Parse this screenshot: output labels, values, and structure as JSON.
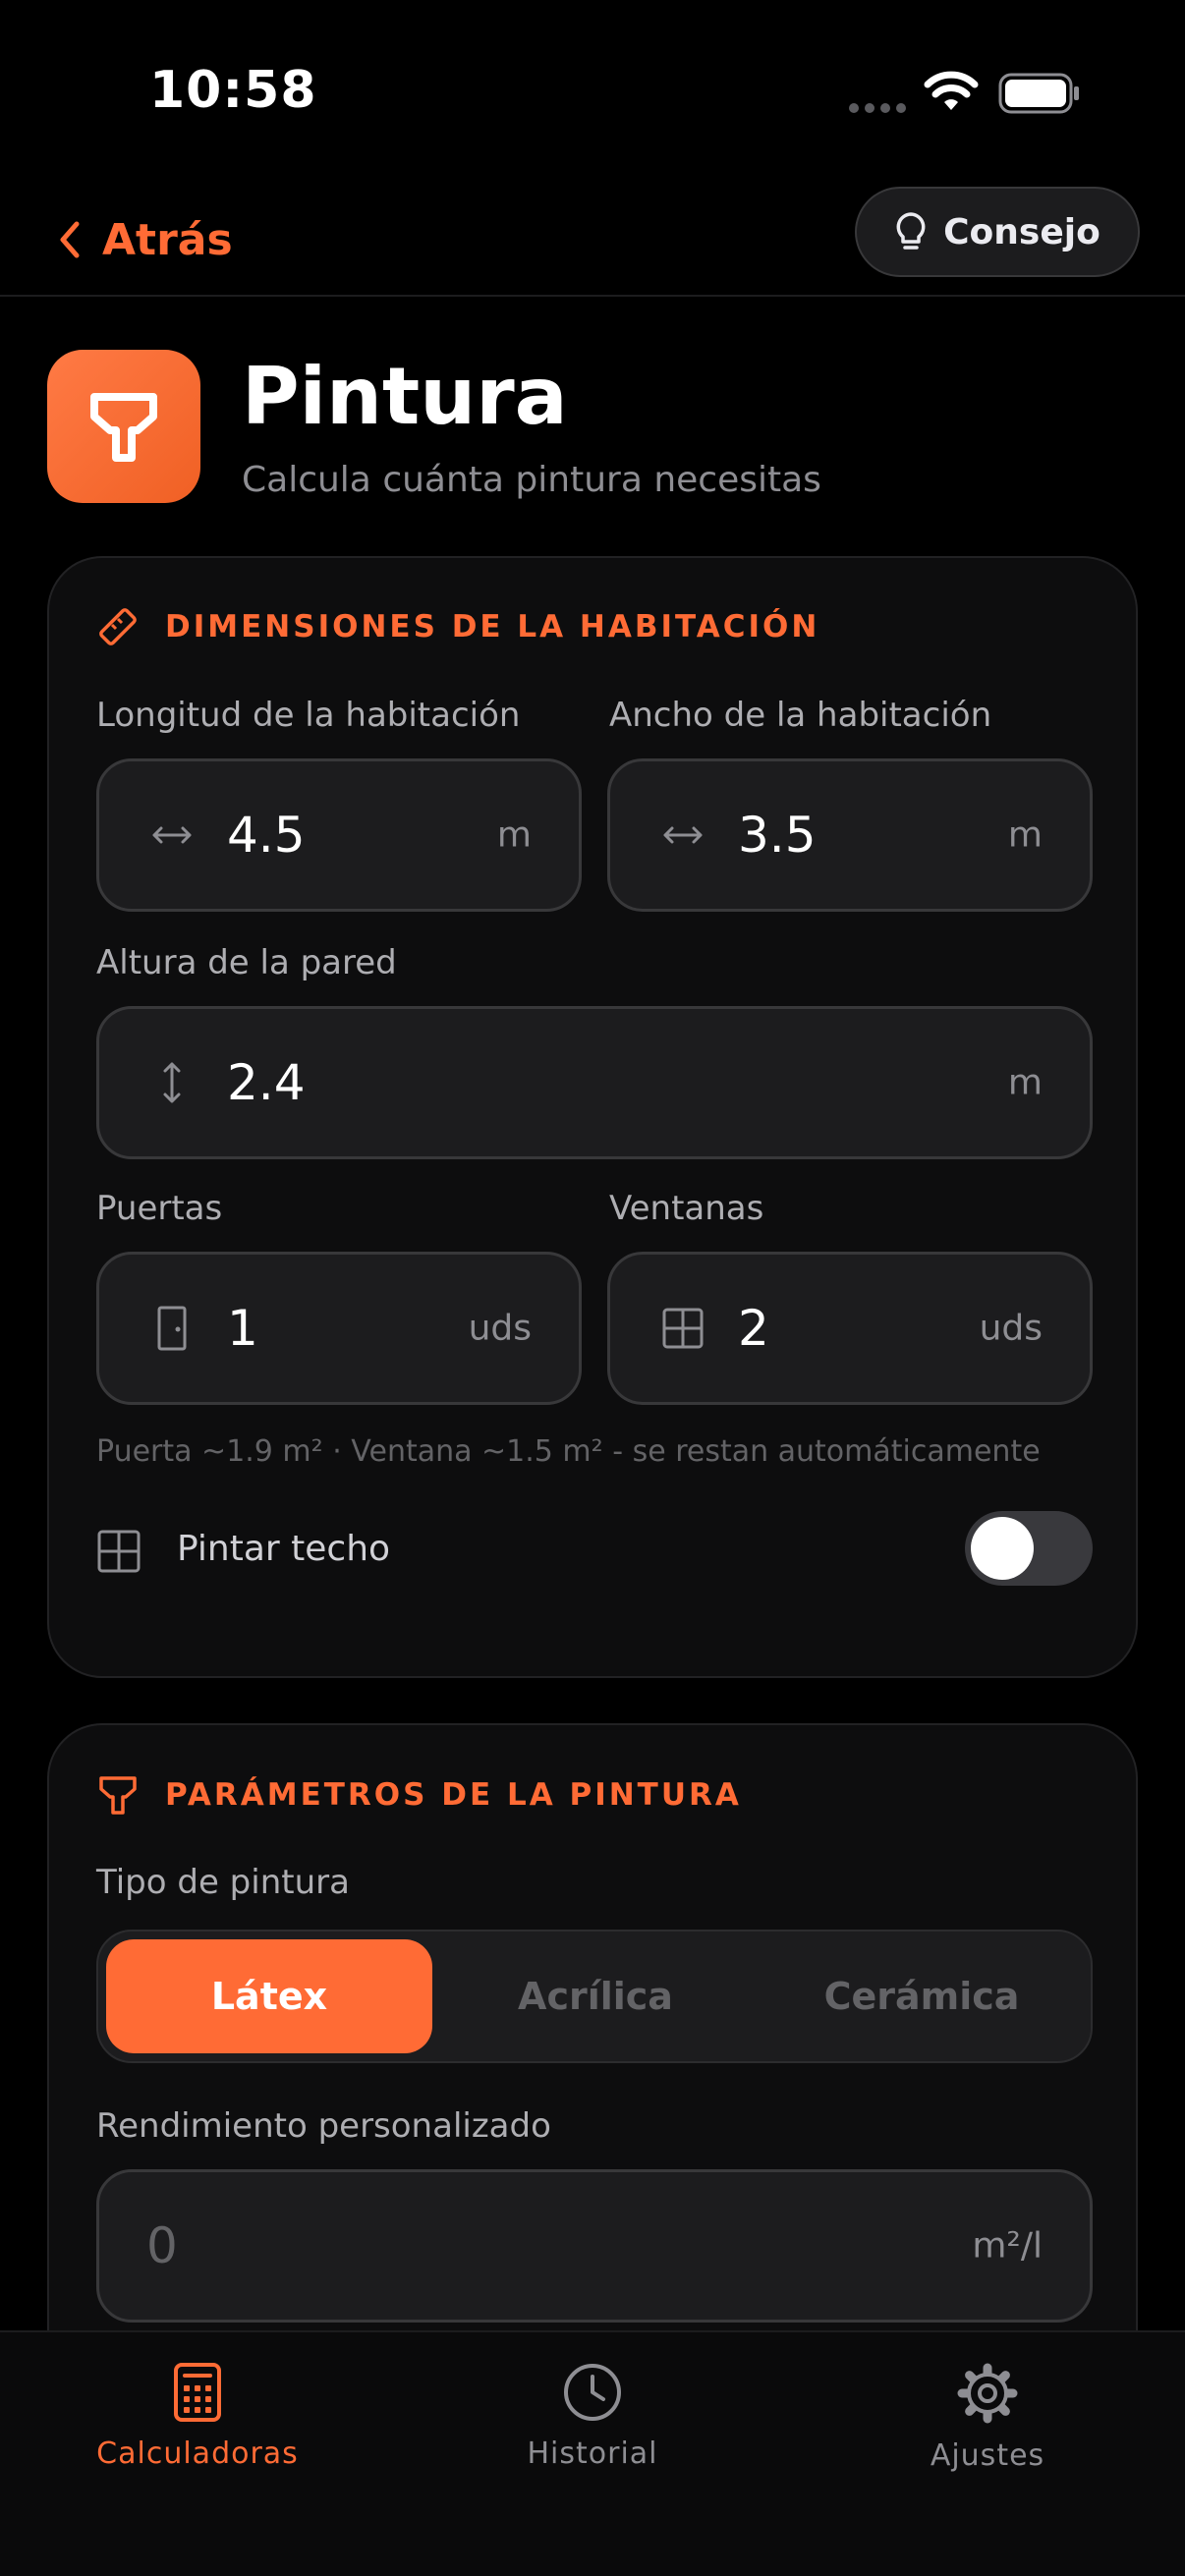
{
  "status_bar": {
    "time": "10:58"
  },
  "nav": {
    "back_label": "Atrás",
    "tip_label": "Consejo"
  },
  "header": {
    "title": "Pintura",
    "subtitle": "Calcula cuánta pintura necesitas",
    "icon": "paint-roller-icon"
  },
  "room": {
    "section_title": "DIMENSIONES DE LA HABITACIÓN",
    "length": {
      "label": "Longitud de la habitación",
      "value": "4.5",
      "unit": "m"
    },
    "width": {
      "label": "Ancho de la habitación",
      "value": "3.5",
      "unit": "m"
    },
    "height": {
      "label": "Altura de la pared",
      "value": "2.4",
      "unit": "m"
    },
    "doors": {
      "label": "Puertas",
      "value": "1",
      "unit": "uds"
    },
    "windows": {
      "label": "Ventanas",
      "value": "2",
      "unit": "uds"
    },
    "hint": "Puerta ~1.9 m² · Ventana ~1.5 m² - se restan automáticamente",
    "ceiling": {
      "label": "Pintar techo",
      "enabled": false
    }
  },
  "paint": {
    "section_title": "PARÁMETROS DE LA PINTURA",
    "type_label": "Tipo de pintura",
    "types": [
      "Látex",
      "Acrílica",
      "Cerámica"
    ],
    "selected_type": "Látex",
    "custom_yield": {
      "label": "Rendimiento personalizado",
      "placeholder": "0",
      "unit": "m²/l"
    }
  },
  "tab_bar": {
    "items": [
      {
        "label": "Calculadoras",
        "icon": "calculator-icon"
      },
      {
        "label": "Historial",
        "icon": "clock-icon"
      },
      {
        "label": "Ajustes",
        "icon": "gear-icon"
      }
    ],
    "active": "Calculadoras"
  },
  "colors": {
    "accent": "#ff6b35",
    "background": "#000000",
    "card": "#0d0d0e",
    "field": "#1c1c1e"
  }
}
